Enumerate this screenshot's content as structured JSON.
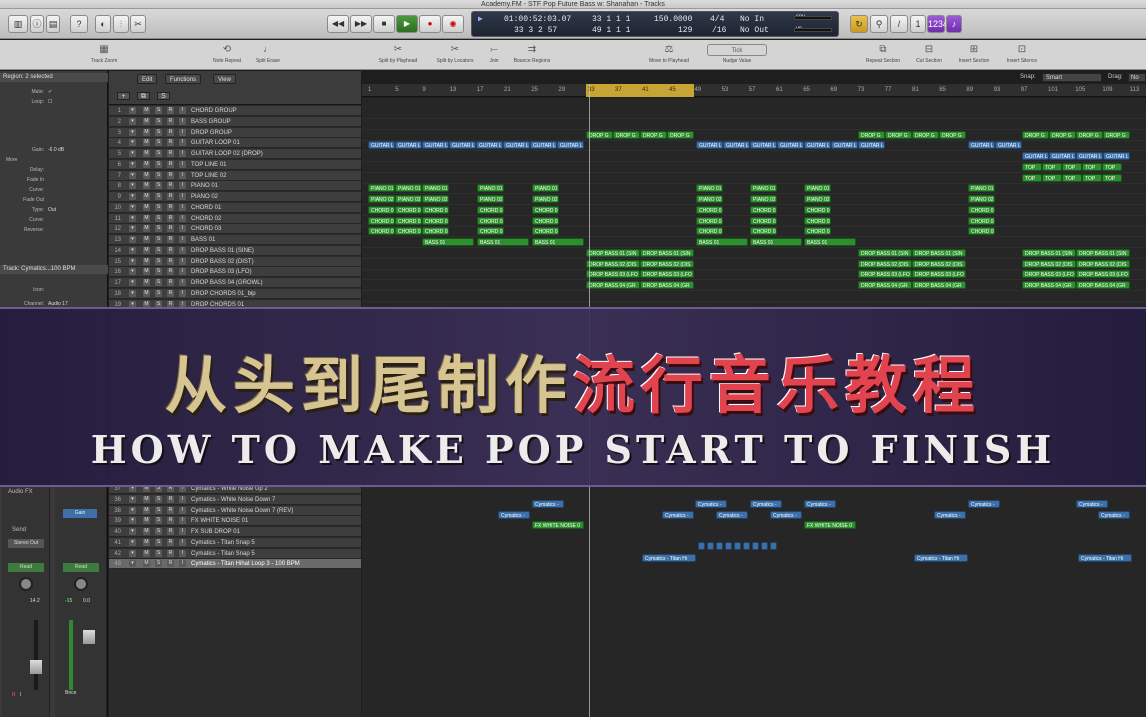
{
  "window": {
    "title": "Academy.FM - STF Pop Future Bass w: Shanahan - Tracks"
  },
  "transport": {
    "position_bars": "01:00:52:03.07",
    "bars_beats": "33  1  1      1",
    "position_row2": "33  3  2    57",
    "bars_row2": "49  1  1      1",
    "tempo": "150.0000",
    "tempo_row2": "129",
    "time_signature": "4/4",
    "division": "/16",
    "midi_in": "No In",
    "midi_out": "No Out",
    "cpu_label": "CPU",
    "hd_label": "HD"
  },
  "toolbar": {
    "items": [
      {
        "label": "Track Zoom",
        "icon": "track-zoom-icon"
      },
      {
        "label": "Note Repeat",
        "icon": "note-repeat-icon"
      },
      {
        "label": "Split Erase",
        "icon": "split-erase-icon"
      },
      {
        "label": "Split by Playhead",
        "icon": "split-playhead-icon"
      },
      {
        "label": "Split by Locators",
        "icon": "split-locators-icon"
      },
      {
        "label": "Join",
        "icon": "join-icon"
      },
      {
        "label": "Bounce Regions",
        "icon": "bounce-regions-icon"
      },
      {
        "label": "Move to Playhead",
        "icon": "move-to-playhead-icon"
      },
      {
        "label": "Tick",
        "icon": "tick-icon"
      },
      {
        "label": "Nudge Value",
        "icon": "nudge-icon"
      },
      {
        "label": "Repeat Section",
        "icon": "repeat-section-icon"
      },
      {
        "label": "Cut Section",
        "icon": "cut-section-icon"
      },
      {
        "label": "Insert Section",
        "icon": "insert-section-icon"
      },
      {
        "label": "Insert Silence",
        "icon": "insert-silence-icon"
      }
    ]
  },
  "inspector": {
    "region_header": "Region: 2 selected",
    "mute_label": "Mute:",
    "loop_label": "Loop:",
    "gain_label": "Gain:",
    "gain_value": "-6.0 dB",
    "more_label": "More",
    "delay_label": "Delay:",
    "fade_in_label": "Fade In",
    "curve_label": "Curve:",
    "fade_out_label": "Fade Out",
    "type_label": "Type:",
    "type_value": "Out",
    "curve2_label": "Curve:",
    "reverse_label": "Reverse:",
    "track_header": "Track: Cymatics...100 BPM",
    "icon_label": "Icon:",
    "channel_label": "Channel:",
    "channel_value": "Audio 17",
    "audio_fx": "Audio FX",
    "send": "Send",
    "stereo_out": "Stereo Out",
    "read1": "Read",
    "read2": "Read",
    "vol1": "14.2",
    "vol2": "-15",
    "vol3": "0.0",
    "strip2_label": "Bnce",
    "gain_btn": "Gain",
    "rec_r": "R",
    "rec_i": "I"
  },
  "track_list": {
    "menu_edit": "Edit",
    "menu_functions": "Functions",
    "menu_view": "View",
    "add_button": "+",
    "tracks": [
      {
        "n": "1",
        "name": "CHORD GROUP"
      },
      {
        "n": "2",
        "name": "BASS GROUP"
      },
      {
        "n": "3",
        "name": "DROP GROUP"
      },
      {
        "n": "4",
        "name": "GUITAR LOOP 01"
      },
      {
        "n": "5",
        "name": "GUITAR LOOP 02 (DROP)"
      },
      {
        "n": "6",
        "name": "TOP LINE 01"
      },
      {
        "n": "7",
        "name": "TOP LINE 02"
      },
      {
        "n": "8",
        "name": "PIANO 01"
      },
      {
        "n": "9",
        "name": "PIANO 02"
      },
      {
        "n": "10",
        "name": "CHORD 01"
      },
      {
        "n": "11",
        "name": "CHORD 02"
      },
      {
        "n": "12",
        "name": "CHORD 03"
      },
      {
        "n": "13",
        "name": "BASS 01"
      },
      {
        "n": "14",
        "name": "DROP BASS 01 (SINE)"
      },
      {
        "n": "15",
        "name": "DROP BASS 02 (DIST)"
      },
      {
        "n": "16",
        "name": "DROP BASS 03 (LFO)"
      },
      {
        "n": "17",
        "name": "DROP BASS 04 (GROWL)"
      },
      {
        "n": "18",
        "name": "DROP CHORDS 01_bip"
      },
      {
        "n": "19",
        "name": "DROP CHORDS 01"
      },
      {
        "n": "37",
        "name": "Cymatics - White Noise Up 2"
      },
      {
        "n": "36",
        "name": "Cymatics - White Noise Down 7"
      },
      {
        "n": "38",
        "name": "Cymatics - White Noise Down 7 (REV)"
      },
      {
        "n": "39",
        "name": "FX WHITE NOISE 01"
      },
      {
        "n": "40",
        "name": "FX SUB DROP 01"
      },
      {
        "n": "41",
        "name": "Cymatics - Titan Snap 5"
      },
      {
        "n": "42",
        "name": "Cymatics - Titan Snap 5"
      },
      {
        "n": "43",
        "name": "Cymatics - Titan Hihat Loop 3 - 100 BPM"
      }
    ]
  },
  "ruler": {
    "snap_label": "Snap:",
    "snap_value": "Smart",
    "drag_label": "Drag:",
    "drag_value": "No",
    "ticks": [
      "1",
      "5",
      "9",
      "13",
      "17",
      "21",
      "25",
      "29",
      "33",
      "37",
      "41",
      "45",
      "49",
      "53",
      "57",
      "61",
      "65",
      "69",
      "73",
      "77",
      "81",
      "85",
      "89",
      "93",
      "97",
      "101",
      "105",
      "109",
      "113"
    ]
  },
  "regions": {
    "drop_group": "DROP G",
    "guitar": "GUITAR L",
    "guitar_drop": "GUITAR L",
    "top_line": "TOP",
    "piano01": "PIANO 01",
    "piano02": "PIANO 02",
    "chord01": "CHORD 01",
    "chord02": "CHORD 02",
    "chord03": "CHORD 03",
    "bass01": "BASS 01",
    "drop_bass_sine": "DROP BASS 01 (SIN",
    "drop_bass_dist": "DROP BASS 02 (DIS",
    "drop_bass_lfo": "DROP BASS 03 (LFO",
    "drop_bass_growl": "DROP BASS 04 (GR",
    "cymatics": "Cymatics -",
    "fx_white_noise": "FX WHITE NOISE 0",
    "titan_hi": "Cymatics - Titan Hi"
  },
  "banner": {
    "cn_gold": "从头到尾制作",
    "cn_red": "流行音乐教程",
    "en": "HOW TO MAKE POP START TO FINISH"
  },
  "colors": {
    "region_green": "#2e8f2e",
    "region_blue": "#3d6fa8",
    "cycle_yellow": "#c8a435",
    "banner_red": "#e1434f",
    "banner_gold": "#d6c493"
  }
}
